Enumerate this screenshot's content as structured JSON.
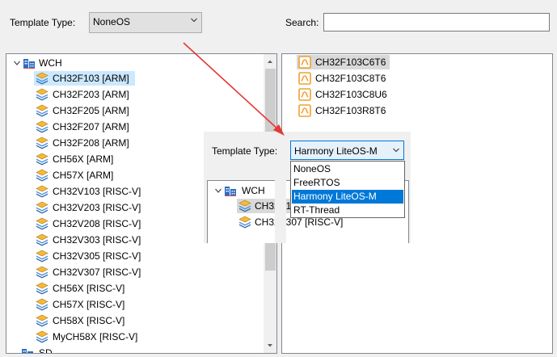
{
  "toolbar": {
    "template_type_label": "Template Type:",
    "template_type_value": "NoneOS",
    "search_label": "Search:",
    "search_value": ""
  },
  "left_tree": {
    "root_label": "WCH",
    "items": [
      {
        "label": "CH32F103 [ARM]",
        "selected": true
      },
      {
        "label": "CH32F203 [ARM]"
      },
      {
        "label": "CH32F205 [ARM]"
      },
      {
        "label": "CH32F207 [ARM]"
      },
      {
        "label": "CH32F208 [ARM]"
      },
      {
        "label": "CH56X [ARM]"
      },
      {
        "label": "CH57X [ARM]"
      },
      {
        "label": "CH32V103 [RISC-V]"
      },
      {
        "label": "CH32V203 [RISC-V]"
      },
      {
        "label": "CH32V208 [RISC-V]"
      },
      {
        "label": "CH32V303 [RISC-V]"
      },
      {
        "label": "CH32V305 [RISC-V]"
      },
      {
        "label": "CH32V307 [RISC-V]"
      },
      {
        "label": "CH56X [RISC-V]"
      },
      {
        "label": "CH57X [RISC-V]"
      },
      {
        "label": "CH58X [RISC-V]"
      },
      {
        "label": "MyCH58X [RISC-V]"
      }
    ],
    "partial_last_label": "SD"
  },
  "right_list": {
    "items": [
      "CH32F103C6T6",
      "CH32F103C8T6",
      "CH32F103C8U6",
      "CH32F103R8T6"
    ]
  },
  "inset": {
    "template_type_label": "Template Type:",
    "template_type_value": "Harmony LiteOS-M",
    "dropdown_options": [
      "NoneOS",
      "FreeRTOS",
      "Harmony LiteOS-M",
      "RT-Thread"
    ],
    "highlighted_option": "Harmony LiteOS-M",
    "tree_root_label": "WCH",
    "tree_items": [
      "CH32V1",
      "CH32V307 [RISC-V]"
    ]
  },
  "colors": {
    "arrow": "#e53935",
    "selection": "#cce8ff",
    "highlight": "#0078d7",
    "chip_icon": "#f0a030"
  }
}
